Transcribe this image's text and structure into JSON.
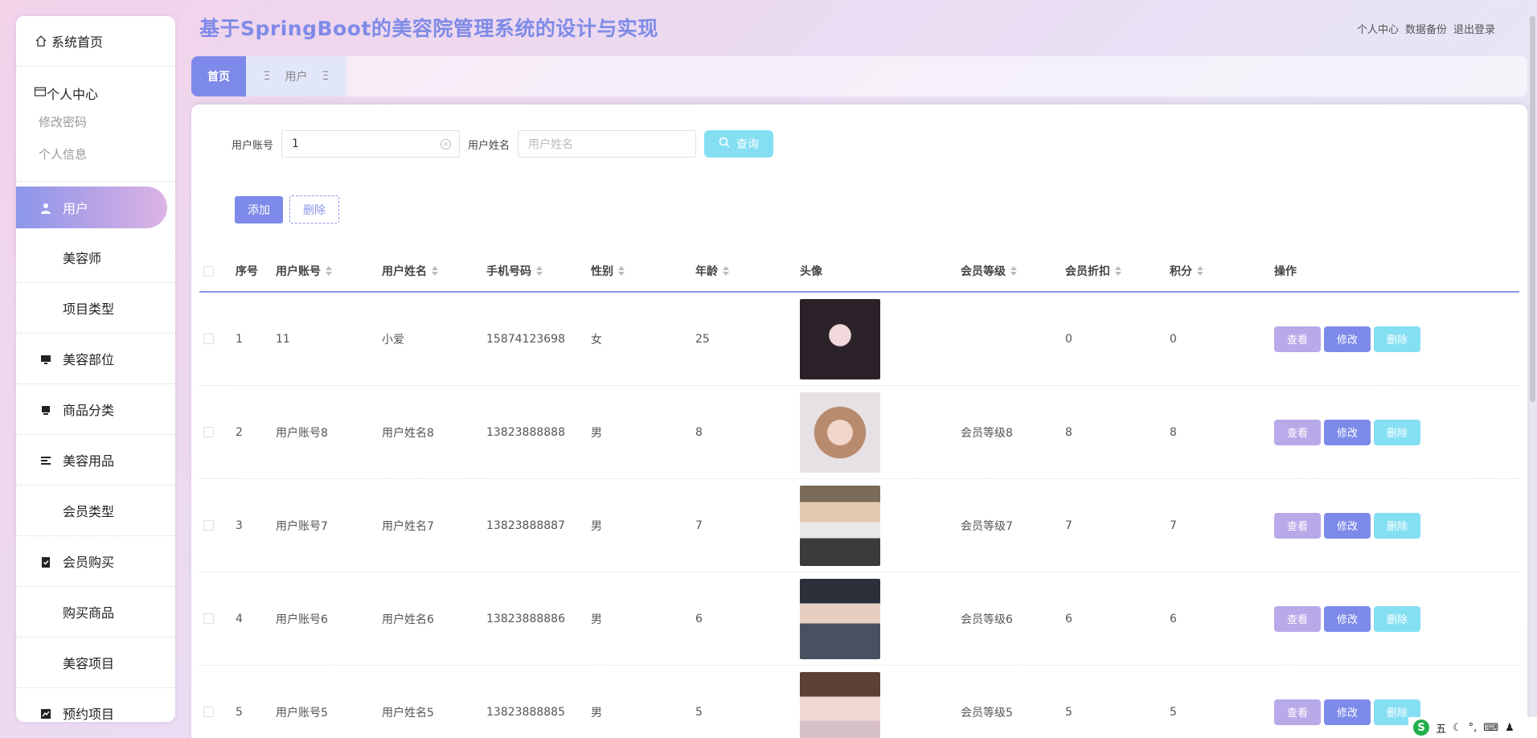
{
  "app": {
    "title": "基于SpringBoot的美容院管理系统的设计与实现"
  },
  "top_links": [
    "个人中心",
    "数据备份",
    "退出登录"
  ],
  "sidebar": {
    "home": "系统首页",
    "personal": {
      "label": "个人中心",
      "subs": [
        "修改密码",
        "个人信息"
      ]
    },
    "menus": [
      "用户",
      "美容师",
      "项目类型",
      "美容部位",
      "商品分类",
      "美容用品",
      "会员类型",
      "会员购买",
      "购买商品",
      "美容项目",
      "预约项目"
    ]
  },
  "tabs": {
    "home": "首页",
    "user": "用户"
  },
  "search": {
    "account_label": "用户账号",
    "account_value": "1",
    "name_label": "用户姓名",
    "name_placeholder": "用户姓名",
    "query_button": "查询"
  },
  "actions": {
    "add": "添加",
    "delete": "删除"
  },
  "table": {
    "headers": [
      "序号",
      "用户账号",
      "用户姓名",
      "手机号码",
      "性别",
      "年龄",
      "头像",
      "会员等级",
      "会员折扣",
      "积分",
      "操作"
    ],
    "row_buttons": {
      "view": "查看",
      "edit": "修改",
      "delete": "删除"
    },
    "rows": [
      {
        "no": "1",
        "account": "11",
        "name": "小爱",
        "phone": "15874123698",
        "gender": "女",
        "age": "25",
        "level": "",
        "discount": "0",
        "points": "0"
      },
      {
        "no": "2",
        "account": "用户账号8",
        "name": "用户姓名8",
        "phone": "13823888888",
        "gender": "男",
        "age": "8",
        "level": "会员等级8",
        "discount": "8",
        "points": "8"
      },
      {
        "no": "3",
        "account": "用户账号7",
        "name": "用户姓名7",
        "phone": "13823888887",
        "gender": "男",
        "age": "7",
        "level": "会员等级7",
        "discount": "7",
        "points": "7"
      },
      {
        "no": "4",
        "account": "用户账号6",
        "name": "用户姓名6",
        "phone": "13823888886",
        "gender": "男",
        "age": "6",
        "level": "会员等级6",
        "discount": "6",
        "points": "6"
      },
      {
        "no": "5",
        "account": "用户账号5",
        "name": "用户姓名5",
        "phone": "13823888885",
        "gender": "男",
        "age": "5",
        "level": "会员等级5",
        "discount": "5",
        "points": "5"
      }
    ]
  },
  "ime": {
    "mode": "五"
  }
}
